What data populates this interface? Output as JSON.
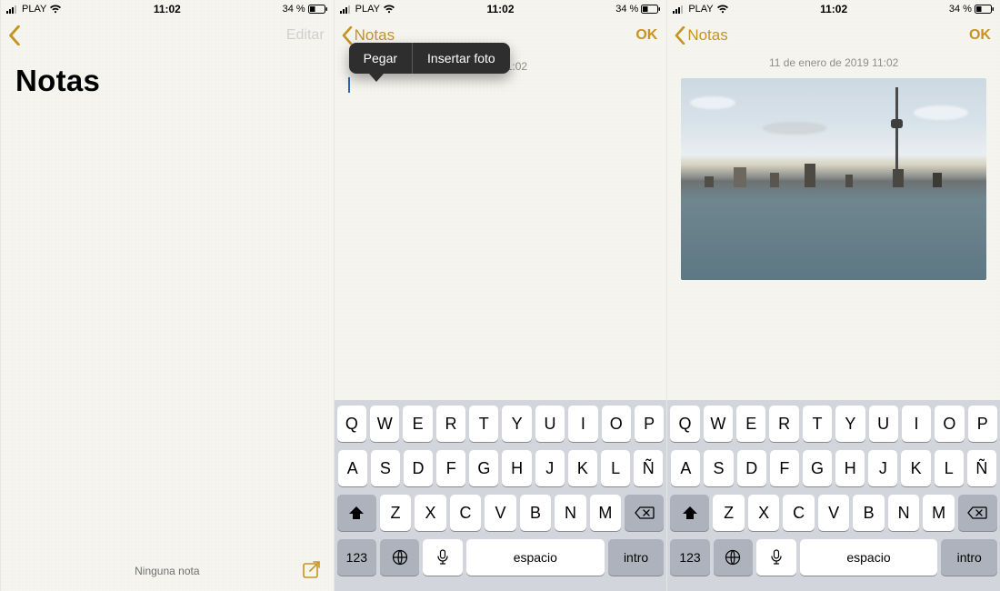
{
  "status": {
    "carrier": "PLAY",
    "time": "11:02",
    "battery_pct": "34 %"
  },
  "colors": {
    "accent": "#c69321",
    "menu_bg": "#2e2e2e"
  },
  "screen1": {
    "edit_label": "Editar",
    "title": "Notas",
    "empty_label": "Ninguna nota"
  },
  "screen2": {
    "back_label": "Notas",
    "done_label": "OK",
    "timestamp_partial": " 2019 11:02",
    "context_menu": {
      "paste": "Pegar",
      "insert_photo": "Insertar foto"
    }
  },
  "screen3": {
    "back_label": "Notas",
    "done_label": "OK",
    "timestamp": "11 de enero de 2019 11:02",
    "photo_desc": "city-skyline-waterfront"
  },
  "keyboard": {
    "row1": [
      "Q",
      "W",
      "E",
      "R",
      "T",
      "Y",
      "U",
      "I",
      "O",
      "P"
    ],
    "row2": [
      "A",
      "S",
      "D",
      "F",
      "G",
      "H",
      "J",
      "K",
      "L",
      "Ñ"
    ],
    "row3": [
      "Z",
      "X",
      "C",
      "V",
      "B",
      "N",
      "M"
    ],
    "numbers_label": "123",
    "space_label": "espacio",
    "return_label": "intro"
  }
}
